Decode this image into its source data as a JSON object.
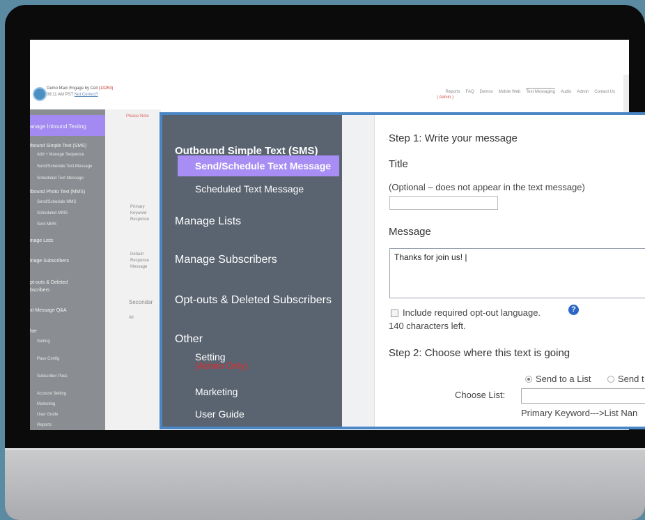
{
  "header": {
    "brand_name": "Demo Main Engage by Cell ",
    "brand_number": "(13253)",
    "time": "09:11 AM PST ",
    "time_link": "Not Correct?",
    "nav": [
      "Reports",
      "FAQ",
      "Demos",
      "Mobile Web",
      "Text Messaging",
      "Audio",
      "Admin",
      "Contact Us"
    ],
    "admin_tag": "( Admin )"
  },
  "bg_sidebar": {
    "highlight": "anage Inbound Texting",
    "items": [
      {
        "label": "tbound Simple Text (SMS)",
        "type": "it"
      },
      {
        "label": "Add + Manage Sequence",
        "type": "sub"
      },
      {
        "label": "Send/Schedule Text Message",
        "type": "sub"
      },
      {
        "label": "Scheduled Text Message",
        "type": "sub"
      },
      {
        "label": "tbound Photo Text (MMS)",
        "type": "it"
      },
      {
        "label": "Send/Schedule MMS",
        "type": "sub"
      },
      {
        "label": "Scheduled MMS",
        "type": "sub"
      },
      {
        "label": "Sent MMS",
        "type": "sub"
      },
      {
        "label": "inage Lists",
        "type": "it"
      },
      {
        "label": "inage Subscribers",
        "type": "it"
      },
      {
        "label": "pt-outs & Deleted",
        "type": "it"
      },
      {
        "label": "bscribers",
        "type": "it"
      },
      {
        "label": "xt Message Q&A",
        "type": "it"
      },
      {
        "label": "her",
        "type": "it"
      },
      {
        "label": "Setting",
        "type": "sub"
      },
      {
        "label": "Pass Config",
        "type": "sub"
      },
      {
        "label": "Subscriber Pass",
        "type": "sub"
      },
      {
        "label": "Account Setting",
        "type": "sub"
      },
      {
        "label": "Marketing",
        "type": "sub"
      },
      {
        "label": "User Guide",
        "type": "sub"
      },
      {
        "label": "Reports",
        "type": "sub"
      }
    ]
  },
  "bg_main": {
    "notice": "Please Note",
    "primary": [
      "Primary",
      "Keyword",
      "Response"
    ],
    "default": [
      "Default",
      "Response",
      "Message"
    ],
    "secondary": "Secondar",
    "all": "All"
  },
  "popup_sidebar": {
    "outbound_header": "Outbound Simple Text (SMS)",
    "send_schedule": "Send/Schedule Text Message",
    "scheduled": "Scheduled Text Message",
    "manage_lists": "Manage Lists",
    "manage_subscribers": "Manage Subscribers",
    "optouts": "Opt-outs & Deleted Subscribers",
    "other": "Other",
    "setting": "Setting",
    "admin_only": "(Admin Only)",
    "marketing": "Marketing",
    "user_guide": "User Guide"
  },
  "form": {
    "step1": "Step 1: Write your message",
    "title_label": "Title",
    "title_hint": "(Optional – does not appear in the text message)",
    "title_value": "",
    "message_label": "Message",
    "message_value": "Thanks for join us! |",
    "optout_label": "Include required opt-out language.",
    "chars_left": "140 characters left.",
    "step2": "Step 2: Choose where this text is going",
    "radio_list": "Send to a List",
    "radio_other": "Send t",
    "choose_list_label": "Choose List:",
    "list_value": "",
    "list_hint": "Primary Keyword--->List Nan"
  }
}
